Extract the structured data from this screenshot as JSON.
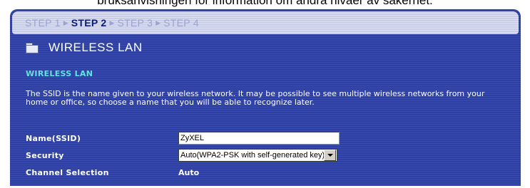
{
  "caption": "bruksanvisningen för information om andra nivåer av säkerhet.",
  "steps": [
    "STEP 1",
    "STEP 2",
    "STEP 3",
    "STEP 4"
  ],
  "active_step": "STEP 2",
  "section": {
    "title": "WIRELESS LAN",
    "icon": "folder-icon"
  },
  "subheading": "WIRELESS LAN",
  "description": "The SSID is the name given to your wireless network. It may be possible to see multiple wireless networks from your home or office, so choose a name that you will be able to recognize later.",
  "form": {
    "ssid_label": "Name(SSID)",
    "ssid_value": "ZyXEL",
    "security_label": "Security",
    "security_value": "Auto(WPA2-PSK with self-generated key)",
    "channel_label": "Channel Selection",
    "channel_value": "Auto"
  },
  "colors": {
    "panel": "#3344a6",
    "steps_bar": "#d6daf0",
    "subheading": "#5fe3e3",
    "text": "#ffffff"
  }
}
